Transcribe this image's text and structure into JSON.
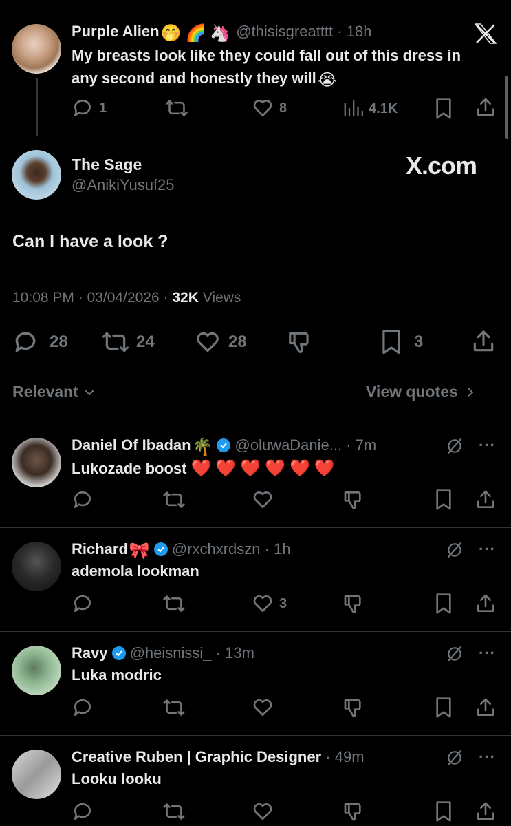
{
  "parent_tweet": {
    "name": "Purple Alien",
    "handle": "@thisisgreatttt",
    "time": "18h",
    "emojis": [
      "🤭",
      "🌈",
      "🦄"
    ],
    "text": "My breasts look like they could fall out of this dress in any second and honestly they will",
    "text_emoji": "😭",
    "replies": "1",
    "likes": "8",
    "views": "4.1K"
  },
  "main_tweet": {
    "name": "The Sage",
    "handle": "@AnikiYusuf25",
    "watermark": "X.com",
    "text": "Can I have a look ?",
    "time": "10:08 PM",
    "date": "03/04/2026",
    "views_count": "32K",
    "views_label": "Views",
    "replies": "28",
    "retweets": "24",
    "likes": "28",
    "bookmarks": "3"
  },
  "sort": {
    "label": "Relevant",
    "quotes_label": "View quotes"
  },
  "replies": [
    {
      "name": "Daniel Of Ibadan",
      "name_emoji": "🌴",
      "verified": true,
      "handle": "@oluwaDanie...",
      "time": "7m",
      "text": "Lukozade boost",
      "hearts": 6,
      "likes": ""
    },
    {
      "name": "Richard",
      "name_emoji": "🎀",
      "verified": true,
      "handle": "@rxchxrdszn",
      "time": "1h",
      "text": "ademola lookman",
      "hearts": 0,
      "likes": "3"
    },
    {
      "name": "Ravy",
      "name_emoji": "",
      "verified": true,
      "handle": "@heisnissi_",
      "time": "13m",
      "text": "Luka modric",
      "hearts": 0,
      "likes": ""
    },
    {
      "name": "Creative Ruben | Graphic Designer",
      "name_emoji": "",
      "verified": false,
      "handle": "",
      "time": "49m",
      "text": "Looku looku",
      "hearts": 0,
      "likes": ""
    }
  ]
}
